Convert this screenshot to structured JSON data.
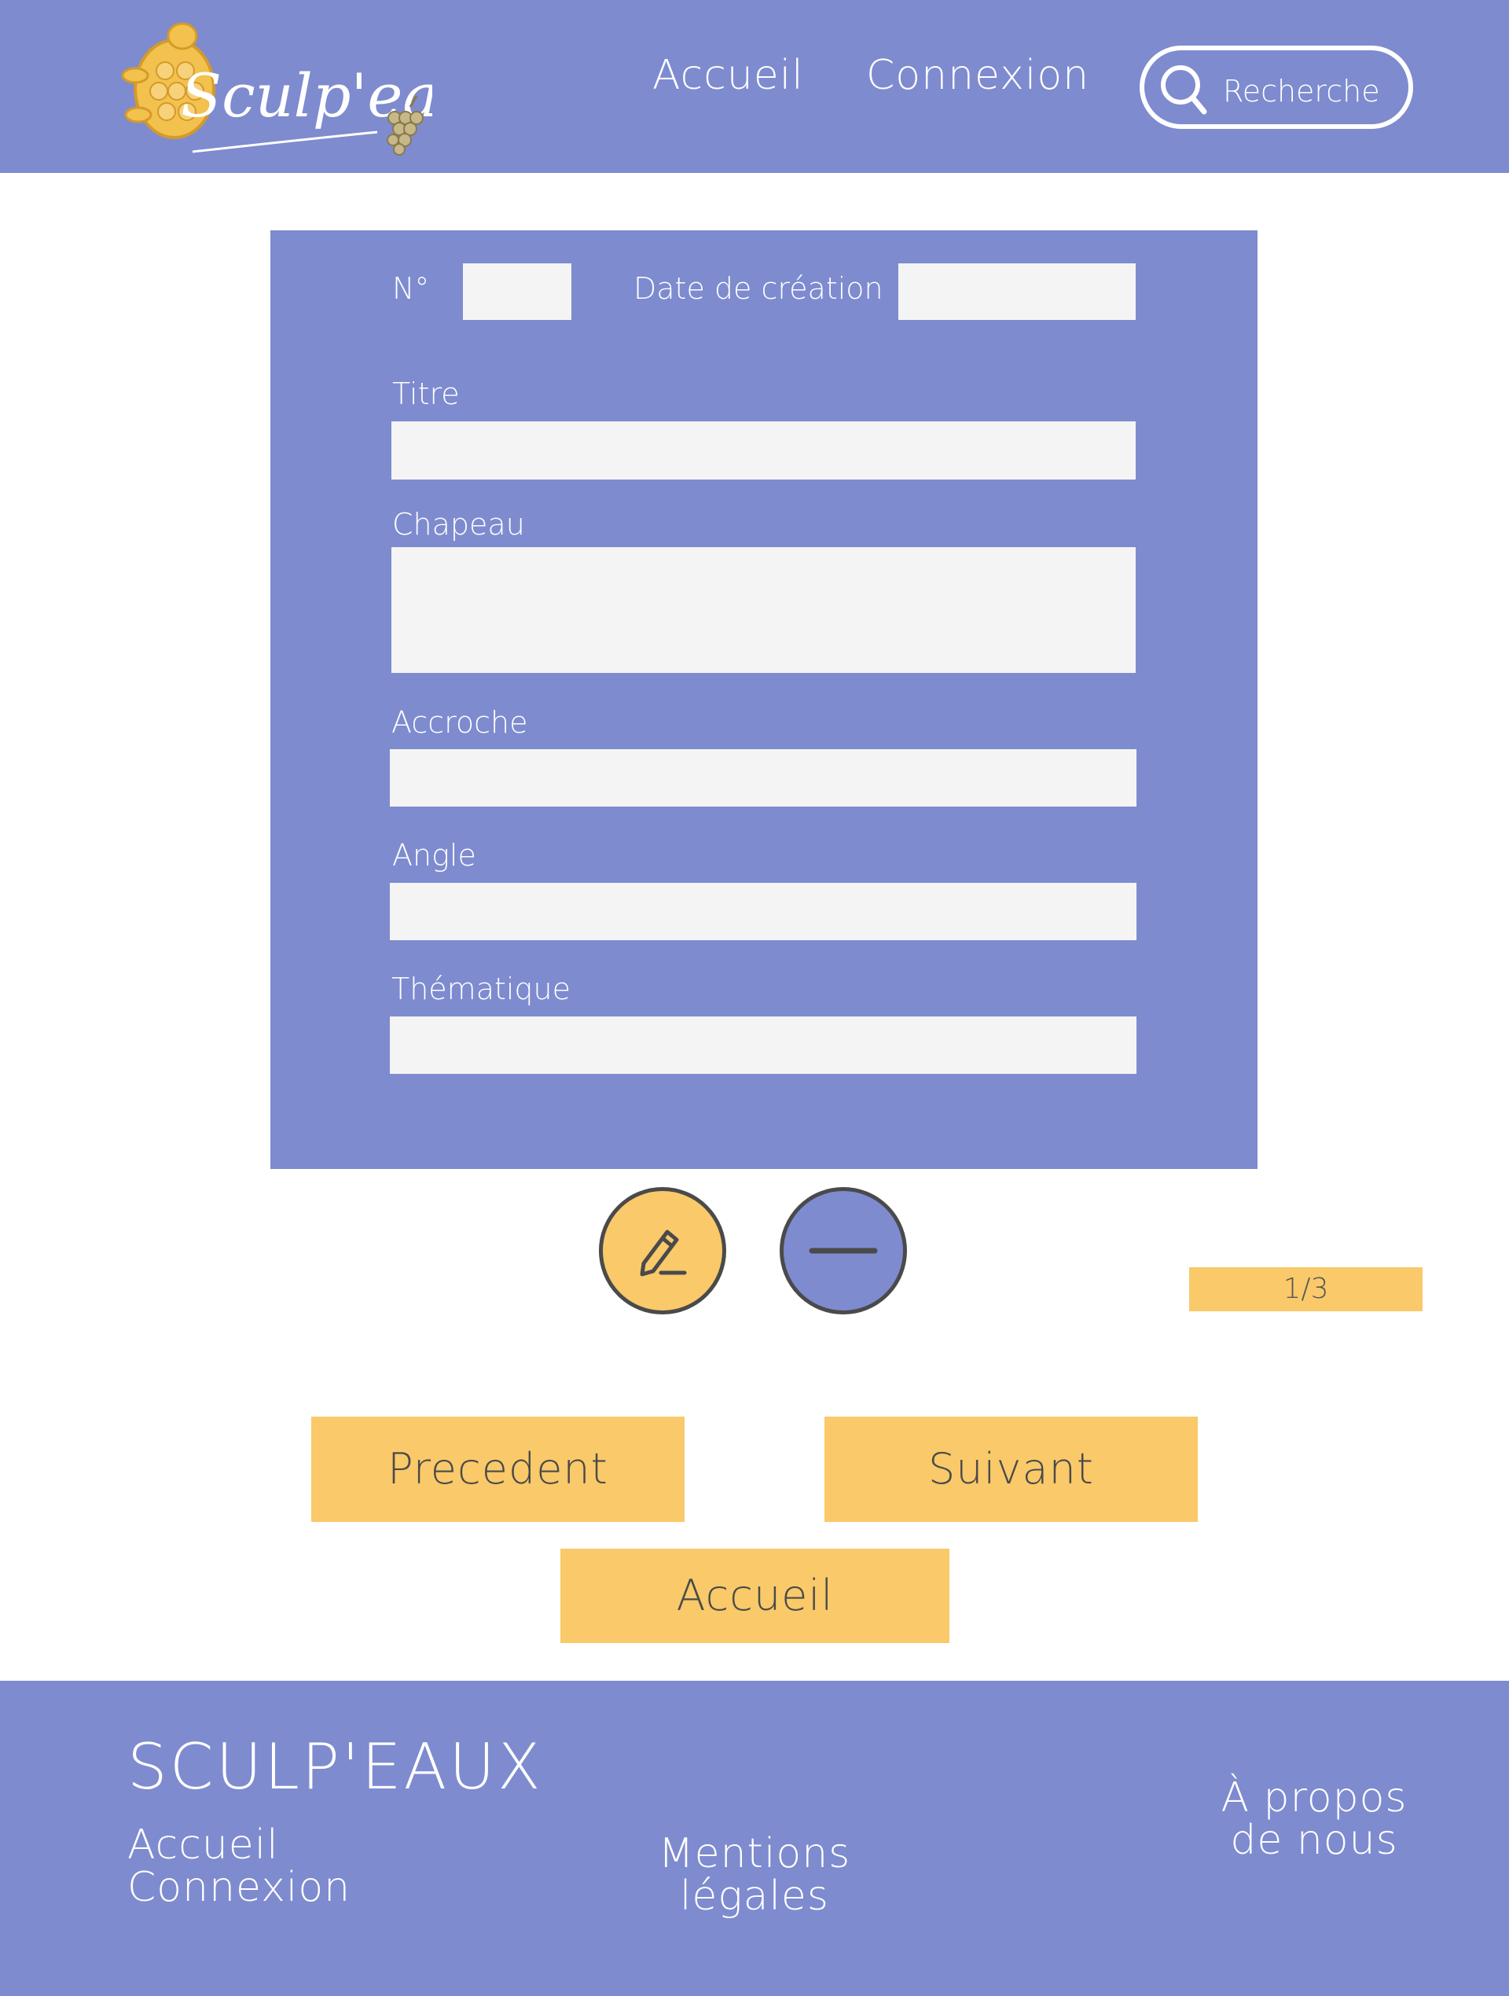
{
  "header": {
    "logo_text": "Sculp'eaux",
    "nav": [
      {
        "label": "Accueil"
      },
      {
        "label": "Connexion"
      }
    ],
    "search": {
      "placeholder": "Recherche",
      "icon": "search-icon"
    }
  },
  "form": {
    "number_label": "N°",
    "date_label": "Date de création",
    "titre_label": "Titre",
    "chapeau_label": "Chapeau",
    "accroche_label": "Accroche",
    "angle_label": "Angle",
    "thematique_label": "Thématique"
  },
  "actions": {
    "edit_icon": "pencil-icon",
    "remove_icon": "minus-icon",
    "page_indicator": "1/3",
    "prev_label": "Precedent",
    "next_label": "Suivant",
    "home_label": "Accueil"
  },
  "footer": {
    "brand": "SCULP'EAUX",
    "accueil": "Accueil",
    "connexion": "Connexion",
    "mentions_line1": "Mentions",
    "mentions_line2": "légales",
    "about_line1": "À propos",
    "about_line2": "de nous"
  },
  "colors": {
    "primary": "#7e8bcf",
    "accent": "#f9c96a",
    "field": "#f4f4f4",
    "text_dark": "#4a4a4a"
  }
}
